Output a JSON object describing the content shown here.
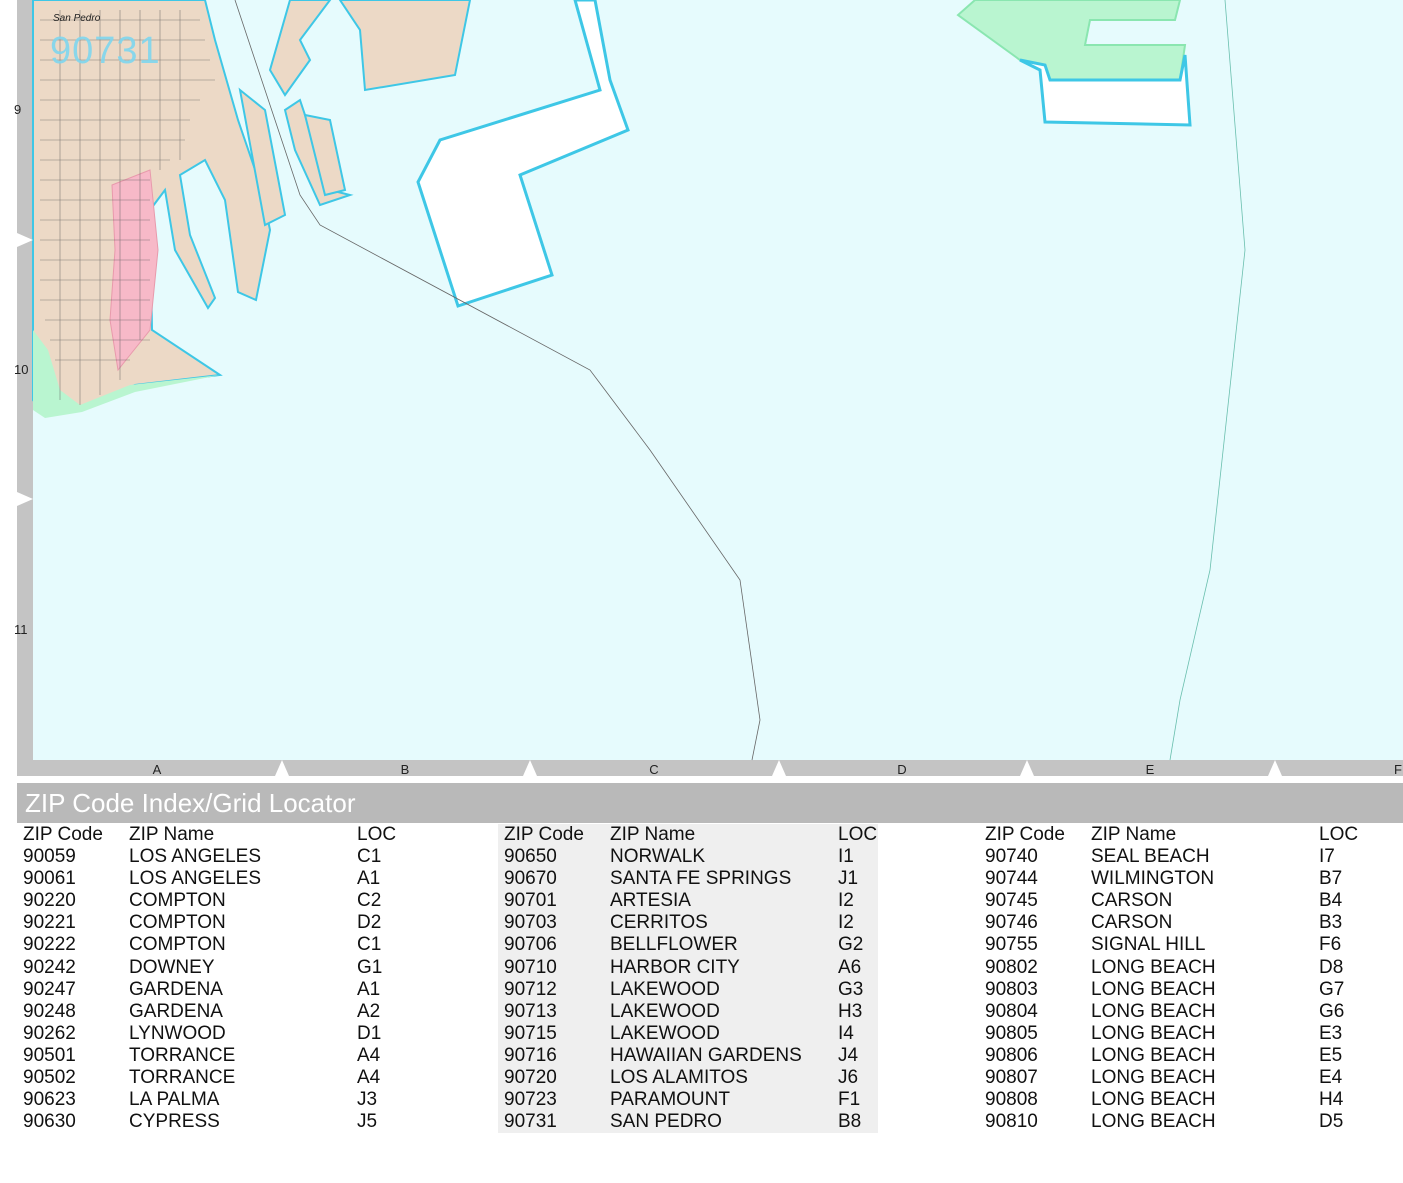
{
  "map": {
    "zip_overlay": "90731",
    "place_name": "San Pedro",
    "row_labels": [
      "9",
      "10",
      "11"
    ],
    "column_labels": [
      "A",
      "B",
      "C",
      "D",
      "E",
      "F"
    ],
    "water_color": "#e6fbfd",
    "land_color": "#ecd9c6",
    "park_color": "#b9f5d0",
    "zip_boundary_color": "#3ec7e6",
    "highlight_color": "#f7b9c8"
  },
  "index": {
    "title": "ZIP Code Index/Grid Locator",
    "headers": {
      "code": "ZIP Code",
      "name": "ZIP Name",
      "loc": "LOC"
    },
    "columns": [
      [
        {
          "code": "90059",
          "name": "LOS ANGELES",
          "loc": "C1"
        },
        {
          "code": "90061",
          "name": "LOS ANGELES",
          "loc": "A1"
        },
        {
          "code": "90220",
          "name": "COMPTON",
          "loc": "C2"
        },
        {
          "code": "90221",
          "name": "COMPTON",
          "loc": "D2"
        },
        {
          "code": "90222",
          "name": "COMPTON",
          "loc": "C1"
        },
        {
          "code": "90242",
          "name": "DOWNEY",
          "loc": "G1"
        },
        {
          "code": "90247",
          "name": "GARDENA",
          "loc": "A1"
        },
        {
          "code": "90248",
          "name": "GARDENA",
          "loc": "A2"
        },
        {
          "code": "90262",
          "name": "LYNWOOD",
          "loc": "D1"
        },
        {
          "code": "90501",
          "name": "TORRANCE",
          "loc": "A4"
        },
        {
          "code": "90502",
          "name": "TORRANCE",
          "loc": "A4"
        },
        {
          "code": "90623",
          "name": "LA PALMA",
          "loc": "J3"
        },
        {
          "code": "90630",
          "name": "CYPRESS",
          "loc": "J5"
        }
      ],
      [
        {
          "code": "90650",
          "name": "NORWALK",
          "loc": "I1"
        },
        {
          "code": "90670",
          "name": "SANTA FE SPRINGS",
          "loc": "J1"
        },
        {
          "code": "90701",
          "name": "ARTESIA",
          "loc": "I2"
        },
        {
          "code": "90703",
          "name": "CERRITOS",
          "loc": "I2"
        },
        {
          "code": "90706",
          "name": "BELLFLOWER",
          "loc": "G2"
        },
        {
          "code": "90710",
          "name": "HARBOR CITY",
          "loc": "A6"
        },
        {
          "code": "90712",
          "name": "LAKEWOOD",
          "loc": "G3"
        },
        {
          "code": "90713",
          "name": "LAKEWOOD",
          "loc": "H3"
        },
        {
          "code": "90715",
          "name": "LAKEWOOD",
          "loc": "I4"
        },
        {
          "code": "90716",
          "name": "HAWAIIAN GARDENS",
          "loc": "J4"
        },
        {
          "code": "90720",
          "name": "LOS ALAMITOS",
          "loc": "J6"
        },
        {
          "code": "90723",
          "name": "PARAMOUNT",
          "loc": "F1"
        },
        {
          "code": "90731",
          "name": "SAN PEDRO",
          "loc": "B8"
        }
      ],
      [
        {
          "code": "90740",
          "name": "SEAL BEACH",
          "loc": "I7"
        },
        {
          "code": "90744",
          "name": "WILMINGTON",
          "loc": "B7"
        },
        {
          "code": "90745",
          "name": "CARSON",
          "loc": "B4"
        },
        {
          "code": "90746",
          "name": "CARSON",
          "loc": "B3"
        },
        {
          "code": "90755",
          "name": "SIGNAL HILL",
          "loc": "F6"
        },
        {
          "code": "90802",
          "name": "LONG BEACH",
          "loc": "D8"
        },
        {
          "code": "90803",
          "name": "LONG BEACH",
          "loc": "G7"
        },
        {
          "code": "90804",
          "name": "LONG BEACH",
          "loc": "G6"
        },
        {
          "code": "90805",
          "name": "LONG BEACH",
          "loc": "E3"
        },
        {
          "code": "90806",
          "name": "LONG BEACH",
          "loc": "E5"
        },
        {
          "code": "90807",
          "name": "LONG BEACH",
          "loc": "E4"
        },
        {
          "code": "90808",
          "name": "LONG BEACH",
          "loc": "H4"
        },
        {
          "code": "90810",
          "name": "LONG BEACH",
          "loc": "D5"
        }
      ]
    ]
  }
}
